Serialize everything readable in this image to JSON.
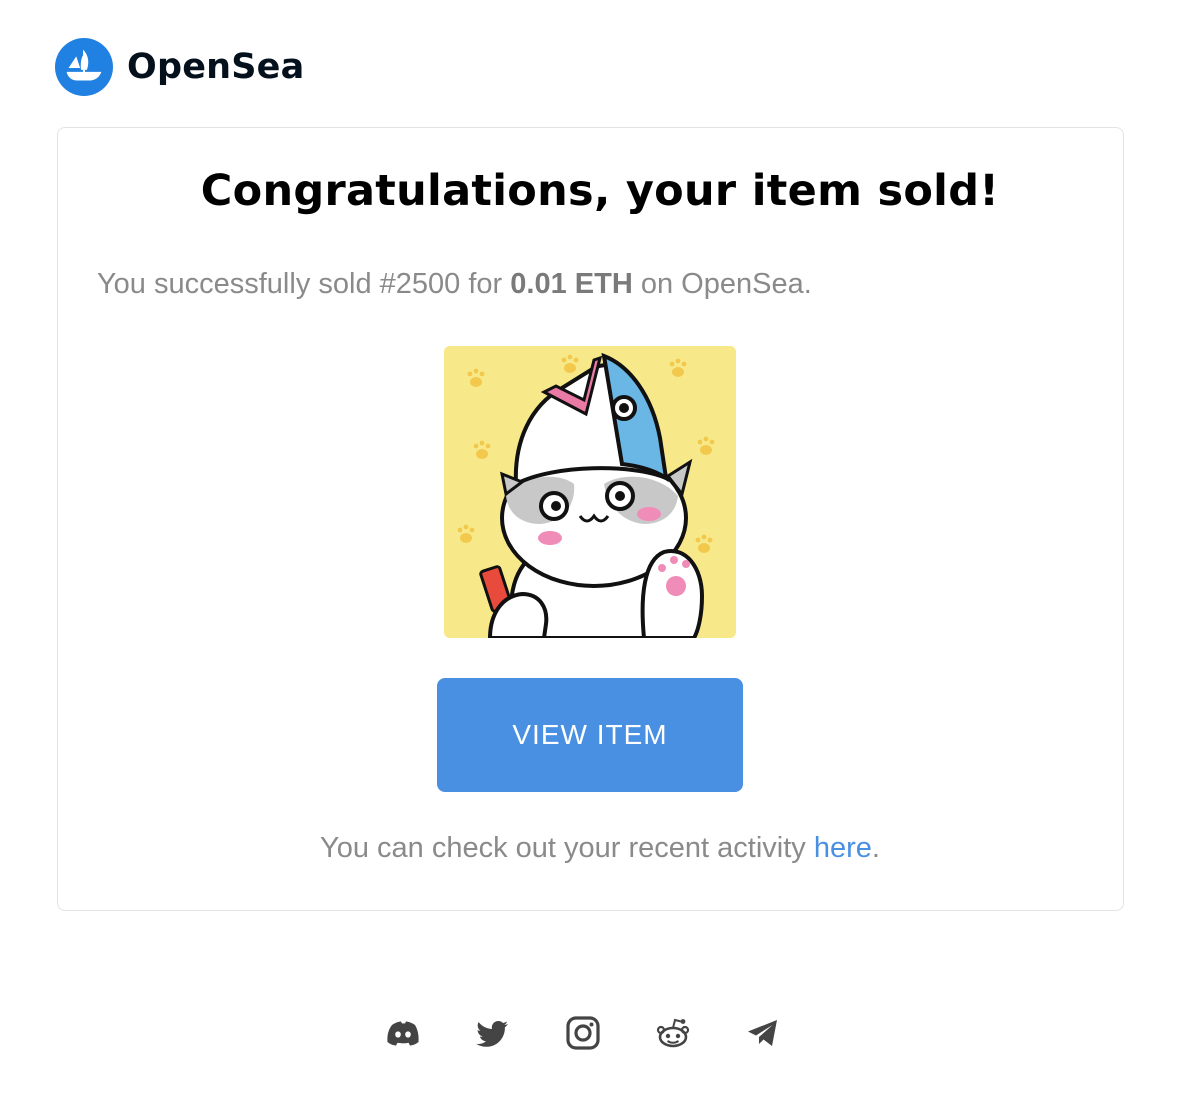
{
  "brand": {
    "name": "OpenSea",
    "logo_icon": "opensea-ship-logo",
    "accent_color": "#2081e2"
  },
  "email": {
    "headline": "Congratulations, your item sold!",
    "sale": {
      "prefix": "You successfully sold",
      "item_name": "#2500",
      "for_word": "for",
      "price": "0.01 ETH",
      "suffix": "on OpenSea."
    },
    "item_image_icon": "cat-nft-artwork",
    "view_button_label": "VIEW ITEM",
    "button_color": "#4a90e2",
    "activity": {
      "text": "You can check out your recent activity",
      "link_label": "here",
      "trailing": "."
    }
  },
  "footer": {
    "socials": [
      {
        "name": "discord-icon"
      },
      {
        "name": "twitter-icon"
      },
      {
        "name": "instagram-icon"
      },
      {
        "name": "reddit-icon"
      },
      {
        "name": "telegram-icon"
      }
    ]
  }
}
